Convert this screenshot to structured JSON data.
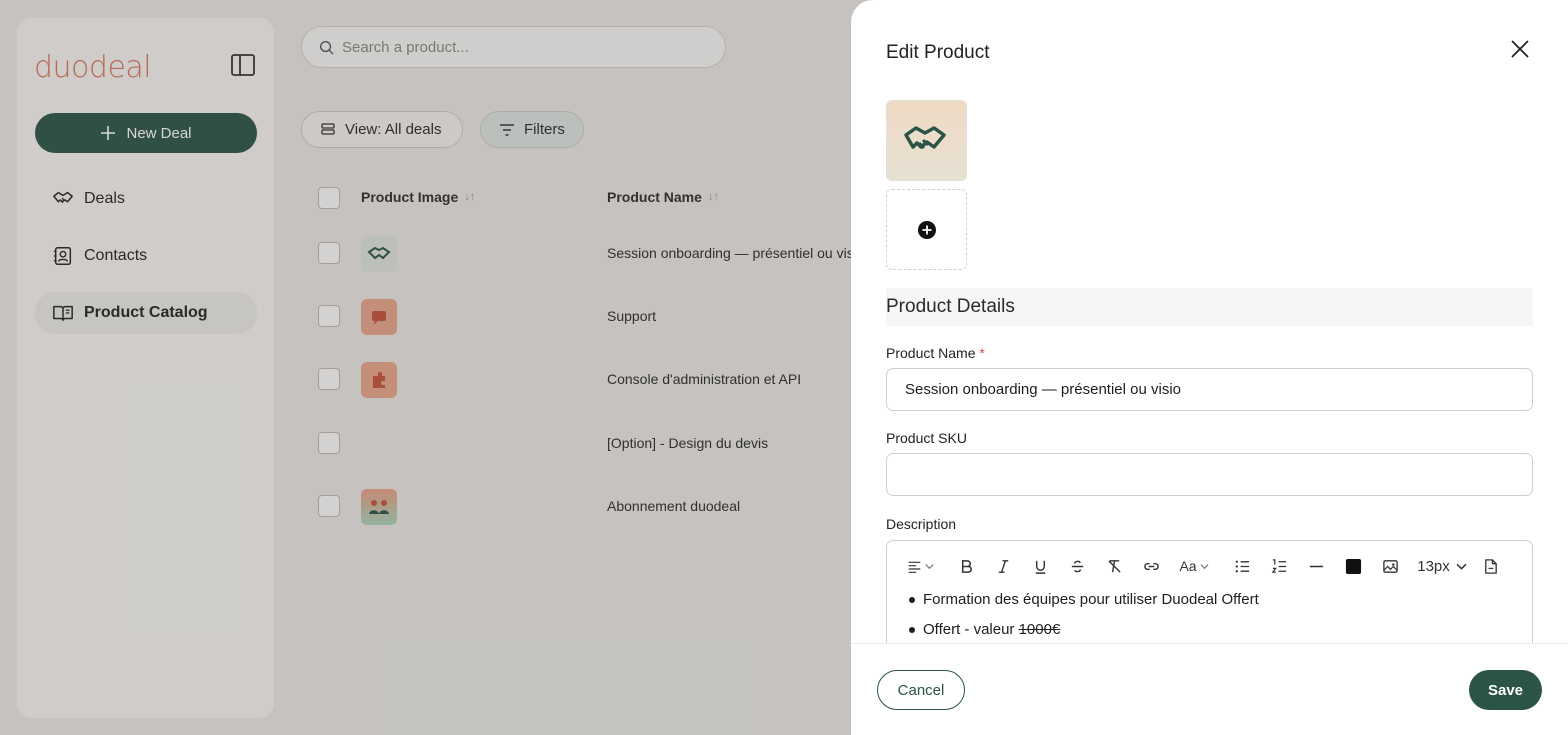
{
  "app": {
    "logo_text": "duodeal"
  },
  "sidebar": {
    "new_deal_label": "New Deal",
    "items": [
      {
        "label": "Deals",
        "icon": "handshake-icon"
      },
      {
        "label": "Contacts",
        "icon": "contacts-icon"
      },
      {
        "label": "Product Catalog",
        "icon": "book-icon",
        "active": true
      }
    ]
  },
  "main": {
    "search": {
      "placeholder": "Search a product..."
    },
    "view_label": "View: All deals",
    "filters_label": "Filters",
    "columns": [
      {
        "label": "Product Image"
      },
      {
        "label": "Product Name"
      }
    ],
    "rows": [
      {
        "name": "Session onboarding — présentiel ou visio",
        "thumb": "handshake"
      },
      {
        "name": "Support",
        "thumb": "chat"
      },
      {
        "name": "Console d'administration et API",
        "thumb": "puzzle"
      },
      {
        "name": "[Option] - Design du devis",
        "thumb": "none"
      },
      {
        "name": "Abonnement duodeal",
        "thumb": "people"
      }
    ]
  },
  "edit_panel": {
    "title": "Edit Product",
    "section_title": "Product Details",
    "product_name_label": "Product Name",
    "required_mark": "*",
    "product_name_value": "Session onboarding — présentiel ou visio",
    "sku_label": "Product SKU",
    "sku_value": "",
    "description_label": "Description",
    "font_size": "13px",
    "description_items": [
      {
        "text": "Formation des équipes pour utiliser Duodeal Offert",
        "strike": ""
      },
      {
        "text": "Offert - valeur ",
        "strike": "1000€"
      }
    ],
    "cancel_label": "Cancel",
    "save_label": "Save"
  },
  "colors": {
    "brand_green": "#2c5446",
    "logo_coral": "#d4775a",
    "required_red": "#d4514b"
  }
}
